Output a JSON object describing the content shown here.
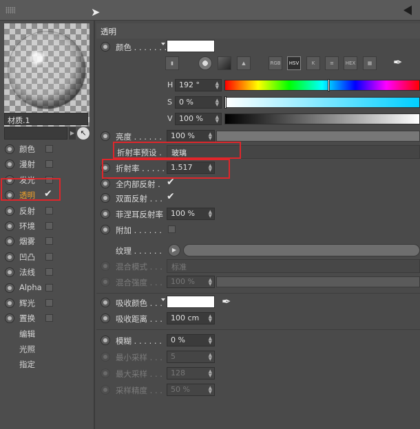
{
  "material": {
    "name": "材质.1",
    "channels": [
      {
        "label": "颜色",
        "checked": false,
        "active": false
      },
      {
        "label": "漫射",
        "checked": false,
        "active": false
      },
      {
        "label": "发光",
        "checked": false,
        "active": false
      },
      {
        "label": "透明",
        "checked": true,
        "active": true
      },
      {
        "label": "反射",
        "checked": false,
        "active": false
      },
      {
        "label": "环境",
        "checked": false,
        "active": false
      },
      {
        "label": "烟雾",
        "checked": false,
        "active": false
      },
      {
        "label": "凹凸",
        "checked": false,
        "active": false
      },
      {
        "label": "法线",
        "checked": false,
        "active": false
      },
      {
        "label": "Alpha",
        "checked": false,
        "active": false
      },
      {
        "label": "辉光",
        "checked": false,
        "active": false
      },
      {
        "label": "置换",
        "checked": false,
        "active": false
      }
    ],
    "extra_items": [
      "编辑",
      "光照",
      "指定"
    ]
  },
  "panel": {
    "section_title": "透明",
    "color_label": "颜色 . . . . . . .",
    "color_swatch": "#ffffff",
    "mode_buttons": [
      "RGB",
      "HSV",
      "K",
      "≡",
      "HEX",
      "▦"
    ],
    "active_mode": "HSV",
    "hsv": {
      "h_label": "H",
      "h_value": "192 °",
      "h_marker": 0.5333,
      "s_label": "S",
      "s_value": "0 %",
      "v_label": "V",
      "v_value": "100 %"
    },
    "brightness_label": "亮度 . . . . . .",
    "brightness_value": "100 %",
    "ior_preset_label": "折射率预设 .",
    "ior_preset_value": "玻璃",
    "ior_label": "折射率 . . . . .",
    "ior_value": "1.517",
    "total_internal_label": "全内部反射 .",
    "total_internal_checked": true,
    "double_sided_label": "双面反射 . . .",
    "double_sided_checked": true,
    "fresnel_label": "菲涅耳反射率",
    "fresnel_value": "100 %",
    "additive_label": "附加 . . . . . .",
    "additive_checked": false,
    "texture_label": "纹理 . . . . . .",
    "blend_mode_label": "混合模式 . . .",
    "blend_mode_value": "标准",
    "blend_strength_label": "混合强度 . . .",
    "blend_strength_value": "100 %",
    "absorption_color_label": "吸收颜色 . . .",
    "absorption_color": "#ffffff",
    "absorption_distance_label": "吸收距离 . . .",
    "absorption_distance_value": "100 cm",
    "blur_label": "模糊 . . . . . .",
    "blur_value": "0 %",
    "min_samples_label": "最小采样 . . .",
    "min_samples_value": "5",
    "max_samples_label": "最大采样 . . .",
    "max_samples_value": "128",
    "accuracy_label": "采样精度 . . .",
    "accuracy_value": "50 %"
  },
  "colors": {
    "highlight": "#e0262b",
    "active_channel": "#f0a12a"
  }
}
